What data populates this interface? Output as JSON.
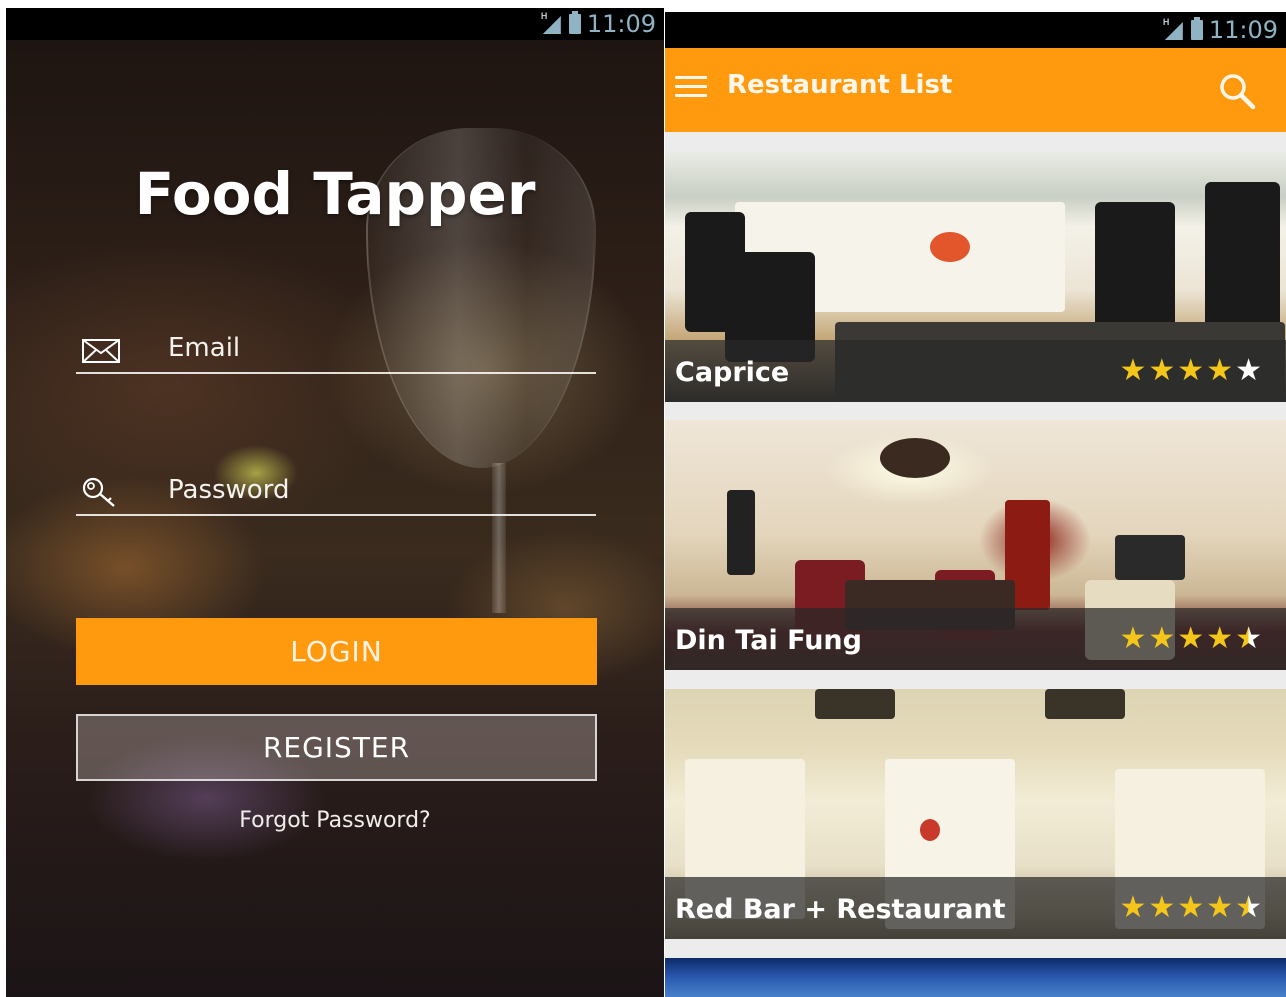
{
  "status_bar": {
    "time": "11:09",
    "network": "H"
  },
  "login_screen": {
    "app_title": "Food Tapper",
    "email_placeholder": "Email",
    "password_placeholder": "Password",
    "login_button": "LOGIN",
    "register_button": "REGISTER",
    "forgot_password": "Forgot Password?"
  },
  "list_screen": {
    "toolbar_title": "Restaurant List",
    "restaurants": [
      {
        "name": "Caprice",
        "rating": 4
      },
      {
        "name": "Din Tai Fung",
        "rating": 4.5
      },
      {
        "name": "Red Bar + Restaurant",
        "rating": 4.5
      }
    ]
  },
  "colors": {
    "accent": "#ff9a0e",
    "star": "#f5c61a",
    "status_text": "#8fb3c3"
  },
  "icons": [
    "signal-icon",
    "battery-icon",
    "envelope-icon",
    "key-icon",
    "menu-icon",
    "search-icon",
    "star-icon"
  ]
}
